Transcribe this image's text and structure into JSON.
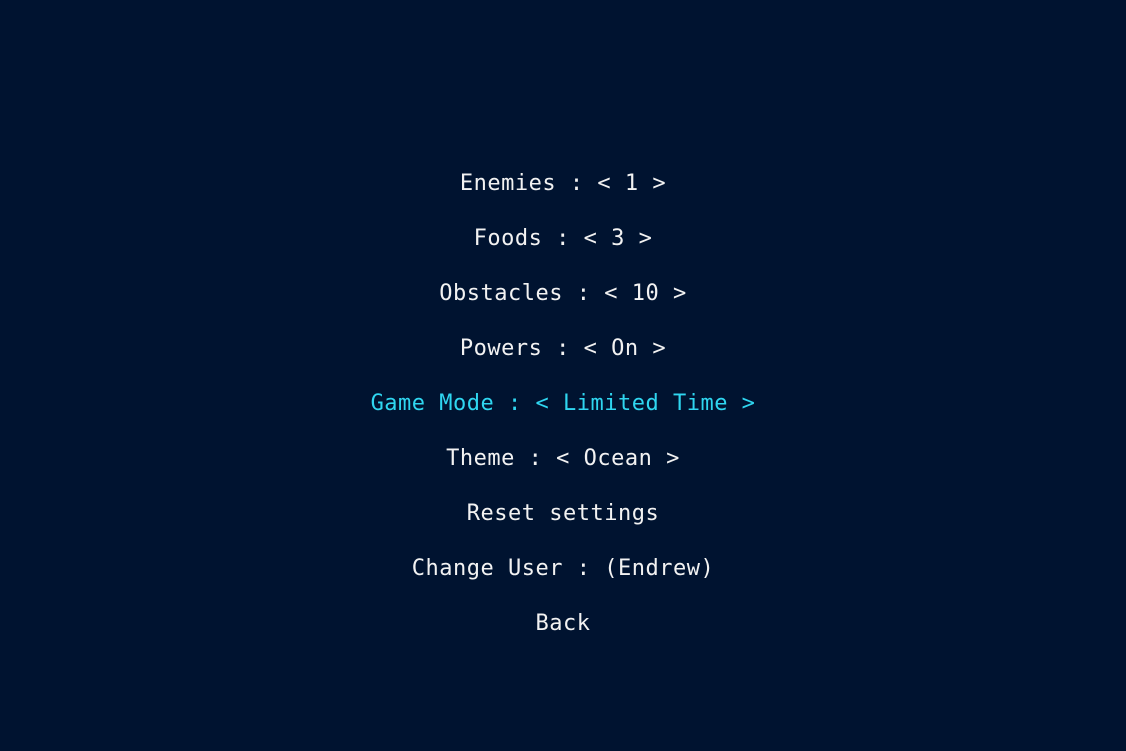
{
  "menu": {
    "selected_index": 4,
    "colors": {
      "background": "#001330",
      "text": "#f2f2f2",
      "selected": "#2fd6f0"
    },
    "items": [
      {
        "label": "Enemies : < 1 >"
      },
      {
        "label": "Foods : < 3 >"
      },
      {
        "label": "Obstacles : < 10 >"
      },
      {
        "label": "Powers : < On >"
      },
      {
        "label": "Game Mode : < Limited Time >"
      },
      {
        "label": "Theme : < Ocean >"
      },
      {
        "label": "Reset settings"
      },
      {
        "label": "Change User : (Endrew)"
      },
      {
        "label": "Back"
      }
    ]
  }
}
